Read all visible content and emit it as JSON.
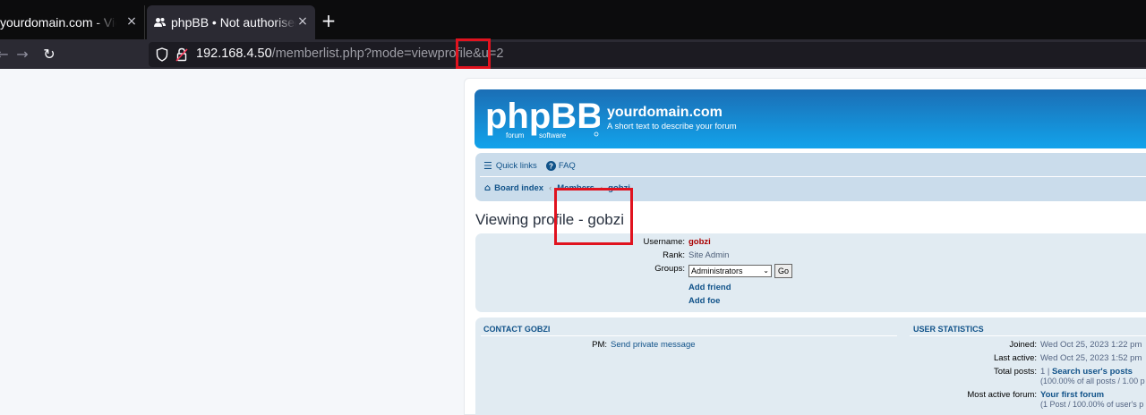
{
  "browser": {
    "tabs": [
      {
        "title": "yourdomain.com - Viewing p",
        "close": "×"
      },
      {
        "title": "phpBB • Not authorised to",
        "close": "×"
      }
    ],
    "new_tab": "+",
    "url_host": "192.168.4.50",
    "url_path": "/memberlist.php?mode=viewprofile&u=2",
    "nav": {
      "back": "←",
      "forward": "→",
      "reload": "↻"
    }
  },
  "site": {
    "logo_text": "phpBB",
    "logo_sub_left": "forum",
    "logo_sub_right": "software",
    "title": "yourdomain.com",
    "description": "A short text to describe your forum"
  },
  "navbar": {
    "quick_links": "Quick links",
    "faq": "FAQ",
    "breadcrumbs": [
      "Board index",
      "Members",
      "gobzi"
    ],
    "breadcrumb_sep": "‹"
  },
  "profile": {
    "title": "Viewing profile - gobzi",
    "labels": {
      "username": "Username:",
      "rank": "Rank:",
      "groups": "Groups:"
    },
    "username": "gobzi",
    "rank": "Site Admin",
    "groups_selected": "Administrators",
    "go_button": "Go",
    "add_friend": "Add friend",
    "add_foe": "Add foe"
  },
  "contact": {
    "heading": "CONTACT GOBZI",
    "pm_label": "PM:",
    "pm_link": "Send private message"
  },
  "stats": {
    "heading": "USER STATISTICS",
    "joined_label": "Joined:",
    "joined": "Wed Oct 25, 2023 1:22 pm",
    "last_active_label": "Last active:",
    "last_active": "Wed Oct 25, 2023 1:52 pm",
    "total_posts_label": "Total posts:",
    "total_posts": "1 |",
    "search_posts": "Search user's posts",
    "posts_pct": "(100.00% of all posts / 1.00 p",
    "most_active_forum_label": "Most active forum:",
    "most_active_forum": "Your first forum",
    "forum_pct": "(1 Post / 100.00% of user's p"
  },
  "colors": {
    "annotation": "#e0131f",
    "header_gradient": [
      "#1b6eb5",
      "#12a3eb"
    ],
    "link": "#105289",
    "username": "#aa0000",
    "panel": "#e1ebf2"
  }
}
